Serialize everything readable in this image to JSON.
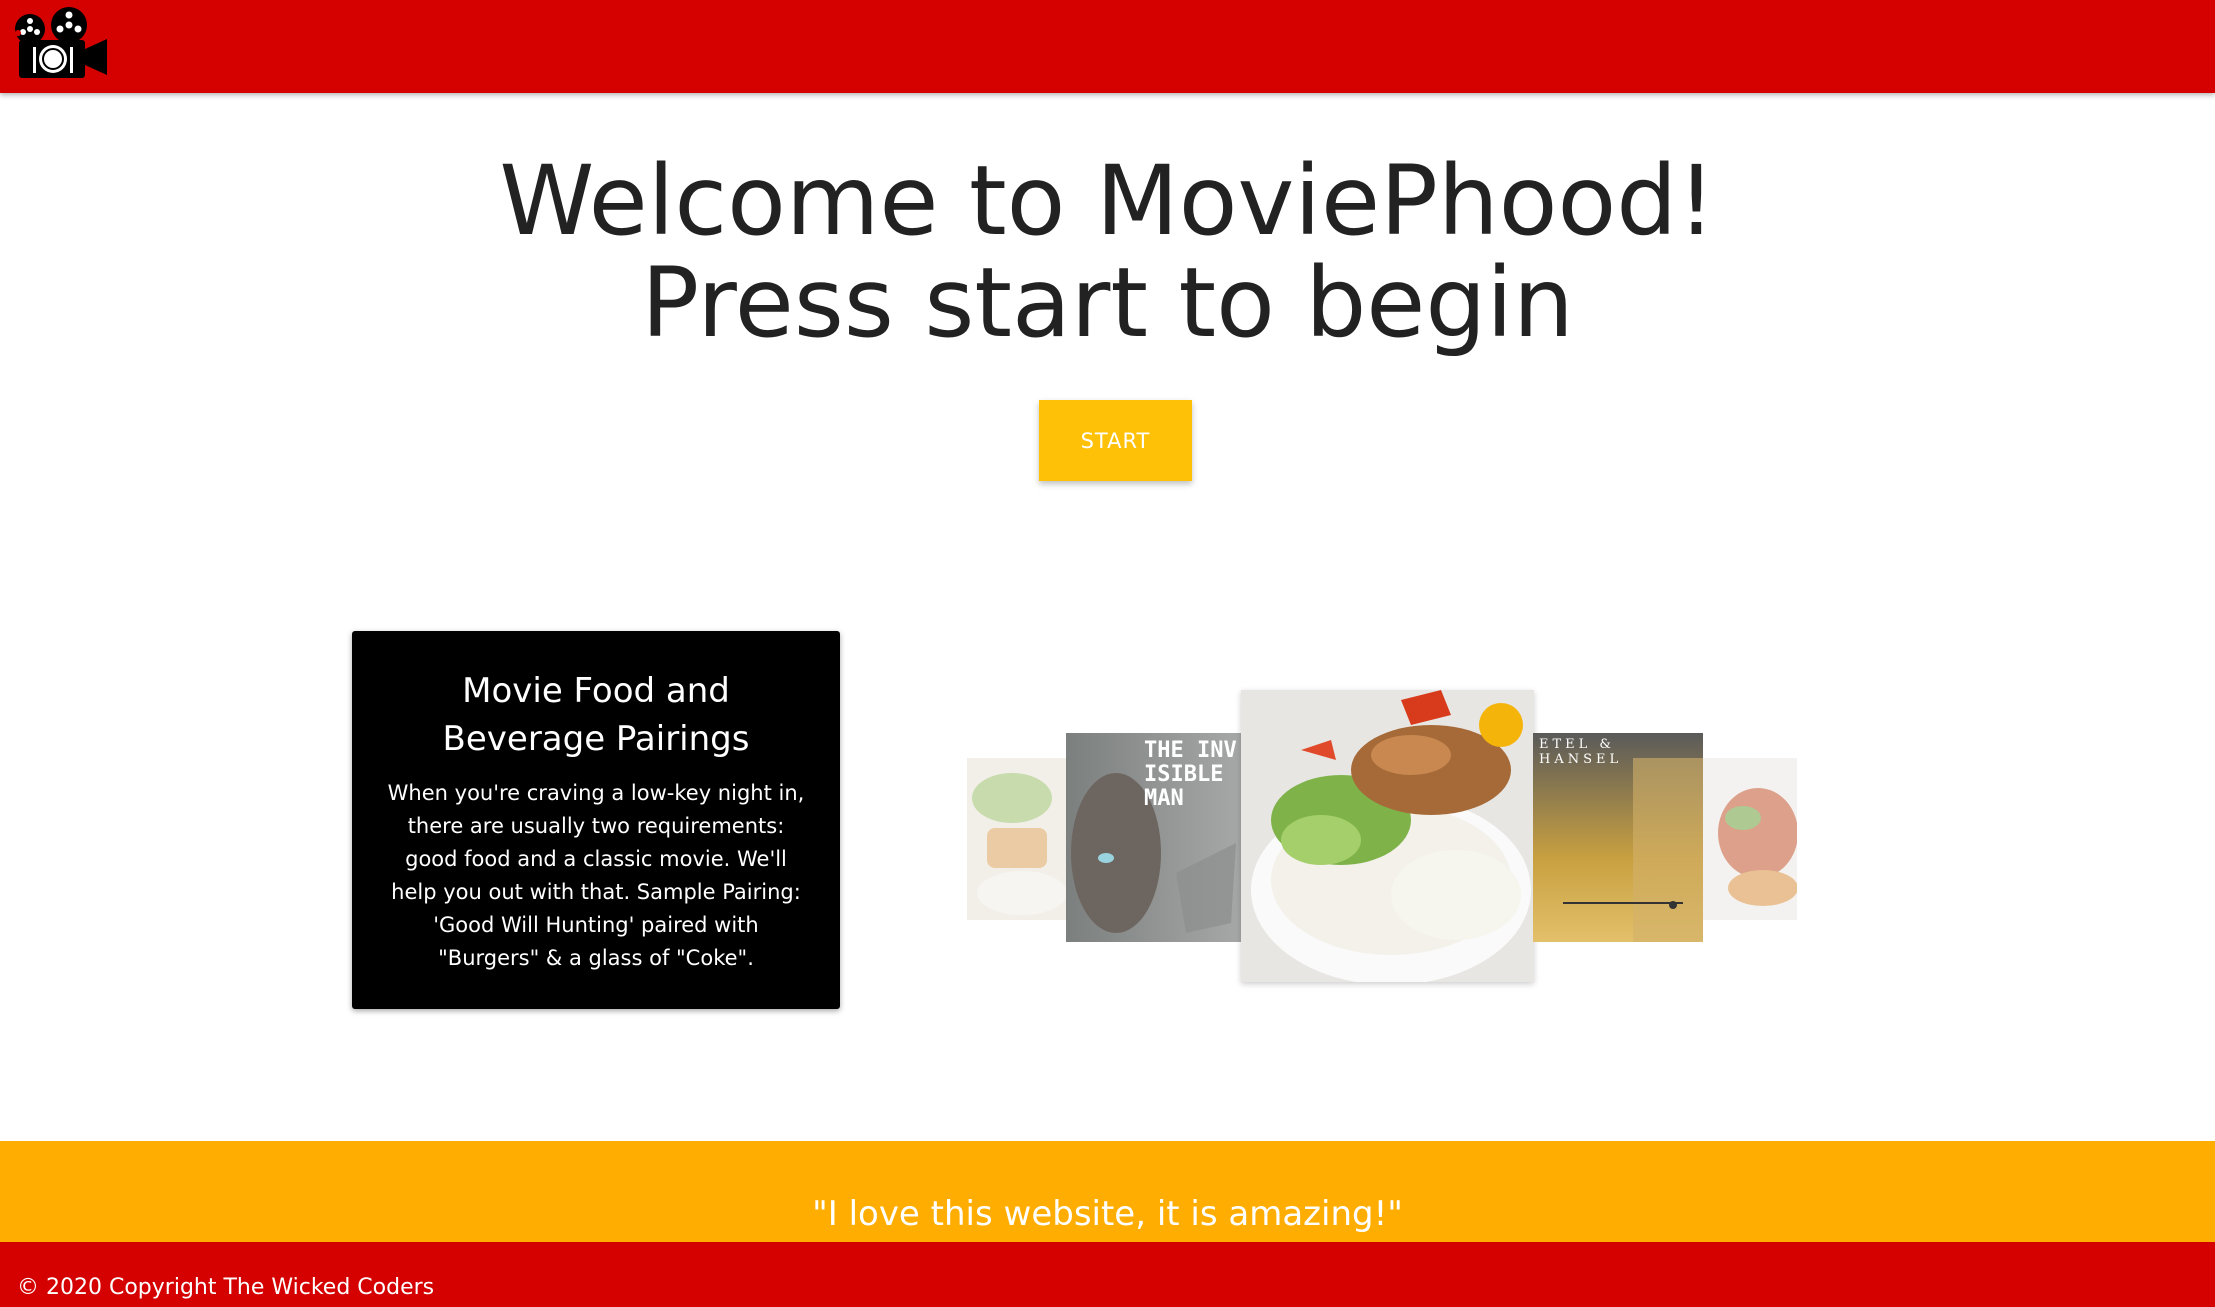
{
  "header": {
    "logo_icon": "film-camera-plate-logo-icon"
  },
  "hero": {
    "title_line1": "Welcome to MoviePhood!",
    "title_line2": "Press start to begin",
    "start_label": "START"
  },
  "card": {
    "title": "Movie Food and Beverage Pairings",
    "text": "When you're craving a low-key night in, there are usually two requirements: good food and a classic movie. We'll help you out with that. Sample Pairing: 'Good Will Hunting' paired with \"Burgers\" & a glass of \"Coke\"."
  },
  "carousel": {
    "poster_invisible_man": "THE INVISIBLE MAN",
    "poster_gretel_hansel": "ETEL & HANSEL"
  },
  "testimonial": {
    "quote": "\"I love this website, it is amazing!\""
  },
  "footer": {
    "copyright": "© 2020 Copyright The Wicked Coders"
  },
  "colors": {
    "nav_red": "#d50000",
    "start_yellow": "#ffc107",
    "testimonial_orange": "#ffad00"
  }
}
